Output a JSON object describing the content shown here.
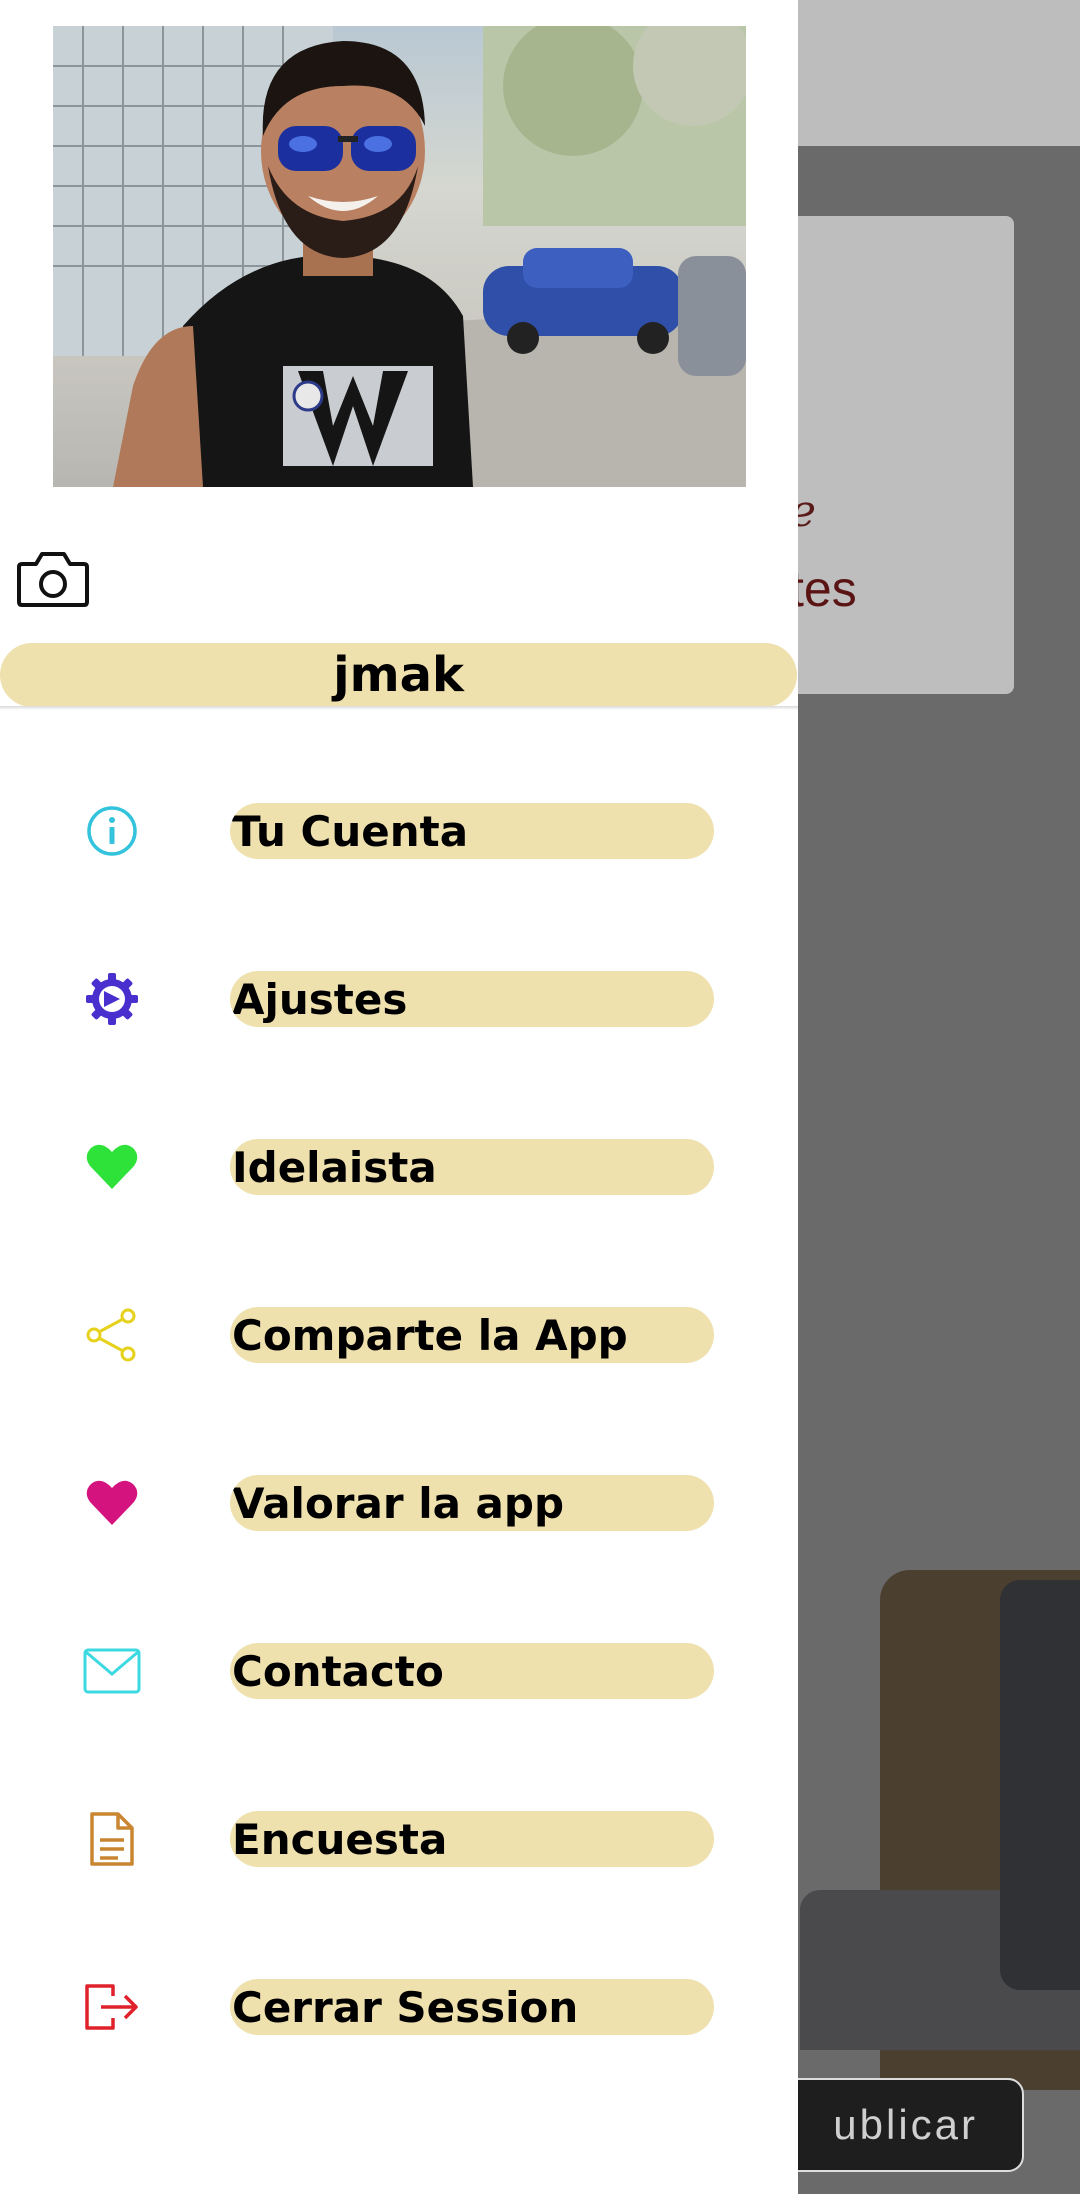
{
  "background": {
    "card_script_text": "e",
    "card_text": "tes",
    "publish_button_label": "ublicar"
  },
  "profile": {
    "username": "jmak",
    "photo_alt": "profile photo"
  },
  "menu": {
    "items": [
      {
        "label": "Tu Cuenta",
        "icon": "info-icon",
        "color": "#33c3dd"
      },
      {
        "label": "Ajustes",
        "icon": "gear-icon",
        "color": "#4a2fcf"
      },
      {
        "label": "Idelaista",
        "icon": "heart-icon",
        "color": "#2ee23a"
      },
      {
        "label": "Comparte la App",
        "icon": "share-icon",
        "color": "#e6d21d"
      },
      {
        "label": "Valorar la app",
        "icon": "heart-icon",
        "color": "#d4137f"
      },
      {
        "label": "Contacto",
        "icon": "mail-icon",
        "color": "#3dd9e0"
      },
      {
        "label": "Encuesta",
        "icon": "document-icon",
        "color": "#c98530"
      },
      {
        "label": "Cerrar Session",
        "icon": "logout-icon",
        "color": "#e0202a"
      }
    ]
  },
  "colors": {
    "pill": "#efe1ad",
    "drawer": "#ffffff",
    "scrim": "#6a6a6a"
  }
}
